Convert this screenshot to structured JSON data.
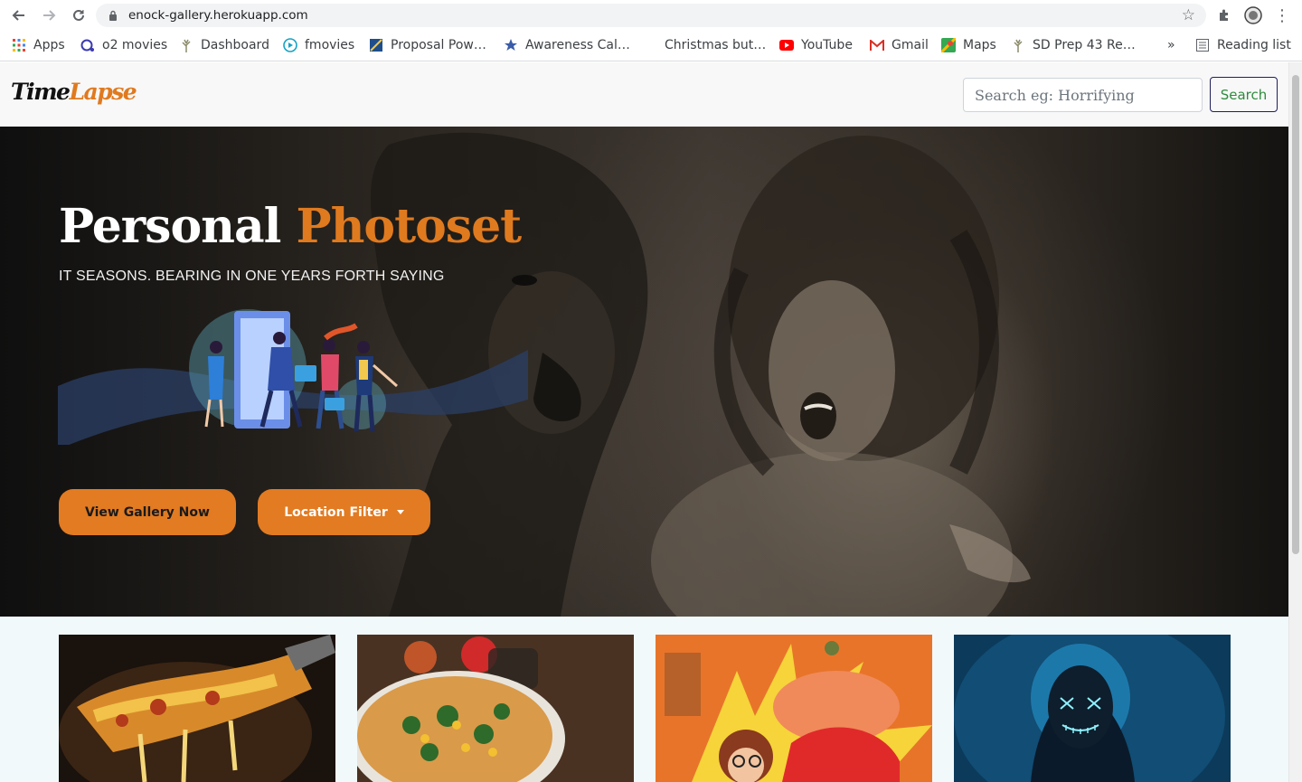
{
  "browser": {
    "url": "enock-gallery.herokuapp.com",
    "bookmarks": [
      {
        "label": "Apps",
        "icon": "apps-grid-icon"
      },
      {
        "label": "o2 movies",
        "icon": "o2-icon"
      },
      {
        "label": "Dashboard",
        "icon": "tree-icon"
      },
      {
        "label": "fmovies",
        "icon": "play-circle-icon"
      },
      {
        "label": "Proposal Pow…",
        "icon": "proposal-icon"
      },
      {
        "label": "Awareness Cal…",
        "icon": "star-icon"
      },
      {
        "label": "Christmas but…",
        "icon": ""
      },
      {
        "label": "YouTube",
        "icon": "youtube-icon"
      },
      {
        "label": "Gmail",
        "icon": "gmail-icon"
      },
      {
        "label": "Maps",
        "icon": "maps-icon"
      },
      {
        "label": "SD Prep 43 Re…",
        "icon": "tree-icon"
      }
    ],
    "overflow_label": "»",
    "reading_list": "Reading list"
  },
  "site": {
    "logo_part1": "Time",
    "logo_part2": "Lapse",
    "search_placeholder": "Search eg: Horrifying",
    "search_button": "Search"
  },
  "hero": {
    "title_part1": "Personal",
    "title_part2": "Photoset",
    "subtitle": "IT SEASONS. BEARING IN ONE YEARS FORTH SAYING",
    "primary_button": "View Gallery Now",
    "filter_button": "Location Filter"
  },
  "gallery": {
    "thumbnails": [
      {
        "subject": "cheese pizza slice"
      },
      {
        "subject": "vegetable pizza"
      },
      {
        "subject": "animated comic scene"
      },
      {
        "subject": "neon mask portrait"
      }
    ]
  },
  "colors": {
    "accent": "#e07a1f",
    "button": "#e27b22",
    "search_border": "#1f1f5c",
    "search_text": "#2e8b3e"
  }
}
